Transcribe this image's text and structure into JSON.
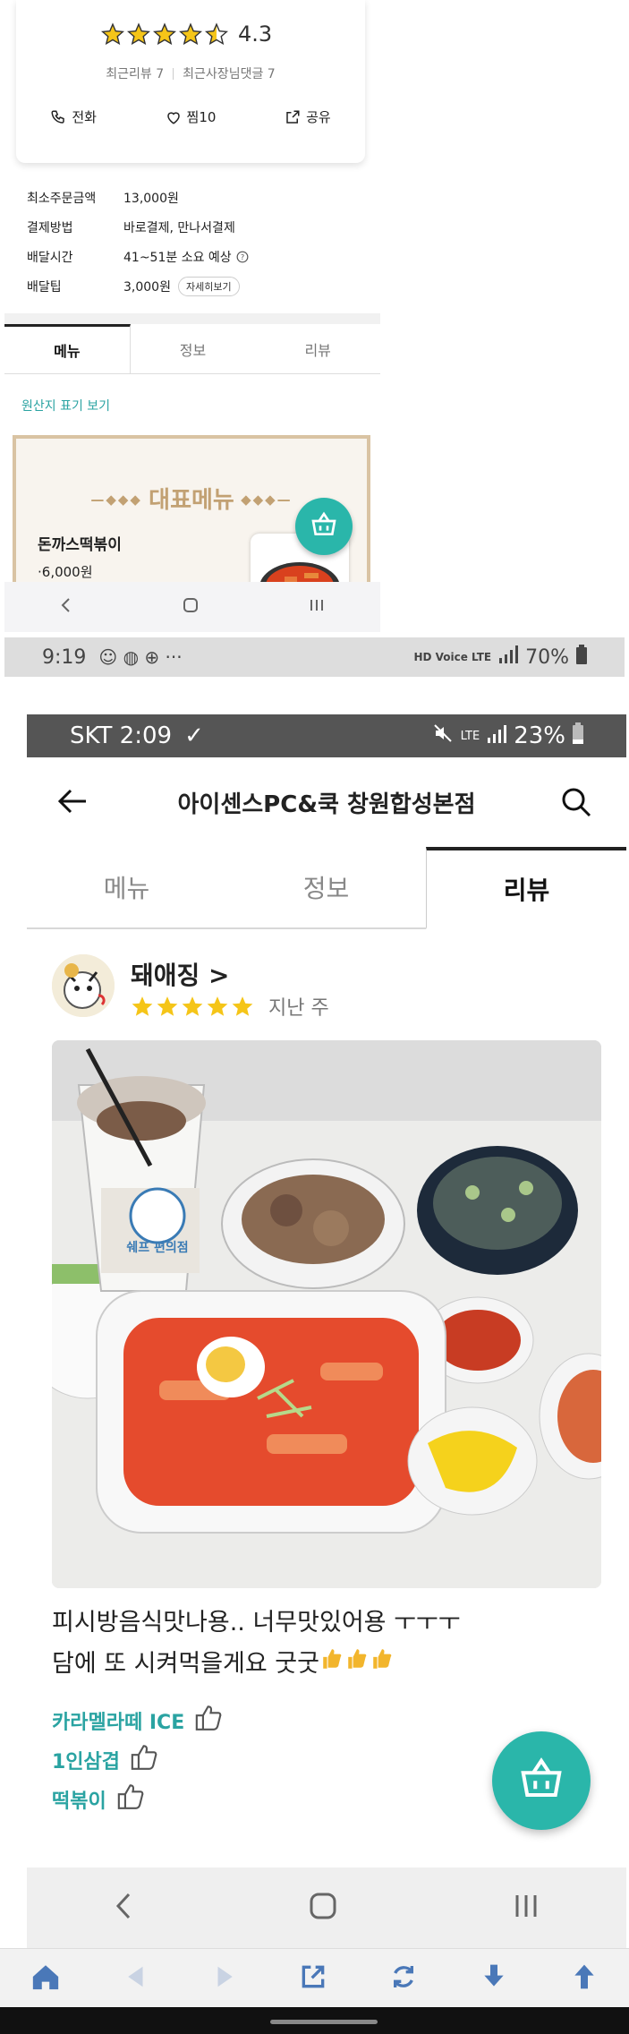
{
  "colors": {
    "accent": "#2aa3a2",
    "cart_bg": "#2ab6aa",
    "star": "#f5c518"
  },
  "top": {
    "rating": "4.3",
    "recent_reviews": "최근리뷰 7",
    "recent_owner_comments": "최근사장님댓글 7",
    "actions": {
      "call": "전화",
      "like": "찜10",
      "share": "공유"
    },
    "info": [
      {
        "label": "최소주문금액",
        "value": "13,000원"
      },
      {
        "label": "결제방법",
        "value": "바로결제, 만나서결제"
      },
      {
        "label": "배달시간",
        "value": "41~51분 소요 예상"
      },
      {
        "label": "배달팁",
        "value": "3,000원"
      }
    ],
    "detail_button": "자세히보기",
    "tabs": [
      "메뉴",
      "정보",
      "리뷰"
    ],
    "origin_link": "원산지 표기 보기",
    "banner_title": "대표메뉴",
    "menu_item": {
      "name": "돈까스떡볶이",
      "price": "6,000원"
    }
  },
  "status2": {
    "time": "9:19",
    "network": "HD Voice LTE",
    "battery": "70%"
  },
  "main": {
    "status": {
      "carrier_time": "SKT 2:09",
      "network": "LTE",
      "battery": "23%"
    },
    "store_name": "아이센스PC&쿡 창원합성본점",
    "tabs": [
      "메뉴",
      "정보",
      "리뷰"
    ],
    "reviewer": "돼애징 >",
    "review_date": "지난 주",
    "review_text_line1": "피시방음식맛나용.. 너무맛있어용 ㅜㅜㅜ",
    "review_text_line2": "담에 또 시켜먹을게요 굿굿",
    "cup_label": "쉐프 편의점",
    "tags": [
      "카라멜라떼 ICE",
      "1인삼겹",
      "떡볶이"
    ]
  },
  "icons": {
    "call": "phone-icon",
    "like": "heart-icon",
    "share": "share-icon",
    "cart": "basket-icon",
    "back": "arrow-left-icon",
    "search": "search-icon",
    "tag": "thumbs-up-icon"
  }
}
